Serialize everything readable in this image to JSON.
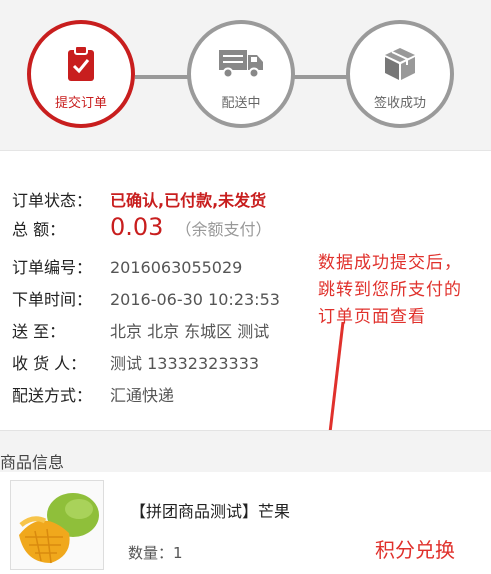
{
  "steps": [
    {
      "label": "提交订单",
      "icon": "clipboard-check-icon",
      "active": true
    },
    {
      "label": "配送中",
      "icon": "delivery-truck-icon",
      "active": false
    },
    {
      "label": "签收成功",
      "icon": "package-box-icon",
      "active": false
    }
  ],
  "order": {
    "status_label": "订单状态：",
    "status_value": "已确认,已付款,未发货",
    "total_label": "总 额：",
    "total_value": "0.03",
    "total_note": "（余额支付）",
    "number_label": "订单编号：",
    "number_value": "2016063055029",
    "time_label": "下单时间：",
    "time_value": "2016-06-30 10:23:53",
    "address_label": "送 至：",
    "address_value": "北京 北京 东城区 测试",
    "receiver_label": "收 货 人：",
    "receiver_value": "测试 13332323333",
    "shipping_label": "配送方式：",
    "shipping_value": "汇通快递"
  },
  "annotation": {
    "lines": [
      "数据成功提交后，",
      "跳转到您所支付的",
      "订单页面查看"
    ]
  },
  "goods": {
    "section_title": "商品信息",
    "product_name": "【拼团商品测试】芒果",
    "quantity_label": "数量：",
    "quantity_value": "1",
    "points_label": "积分兑换"
  },
  "colors": {
    "accent": "#c81e1e",
    "annotation": "#e0312c",
    "muted": "#9a9a9a"
  }
}
